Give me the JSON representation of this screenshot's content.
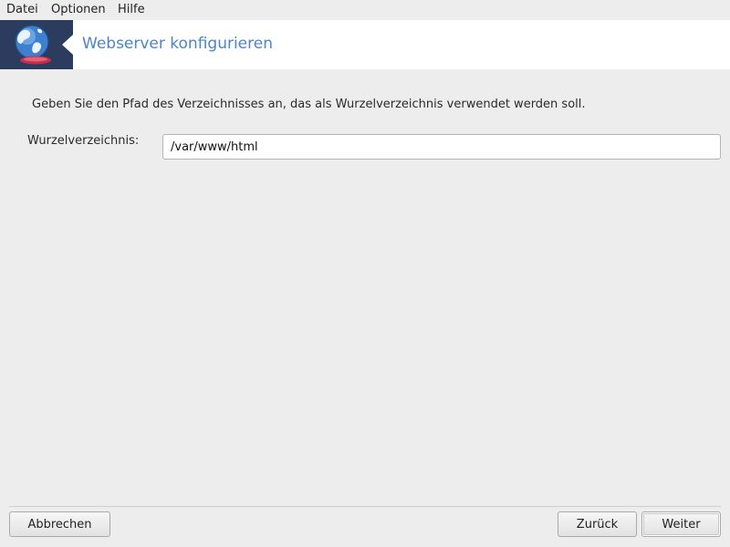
{
  "menubar": {
    "items": [
      "Datei",
      "Optionen",
      "Hilfe"
    ]
  },
  "banner": {
    "title": "Webserver konfigurieren",
    "logo_icon": "globe-icon",
    "logo_bg": "#2b3c5e",
    "title_color": "#4b85c8"
  },
  "content": {
    "instruction": "Geben Sie den Pfad des Verzeichnisses an, das als Wurzelverzeichnis verwendet werden soll.",
    "field_label": "Wurzelverzeichnis:",
    "field_value": "/var/www/html"
  },
  "buttons": {
    "cancel": "Abbrechen",
    "back": "Zurück",
    "next": "Weiter"
  }
}
